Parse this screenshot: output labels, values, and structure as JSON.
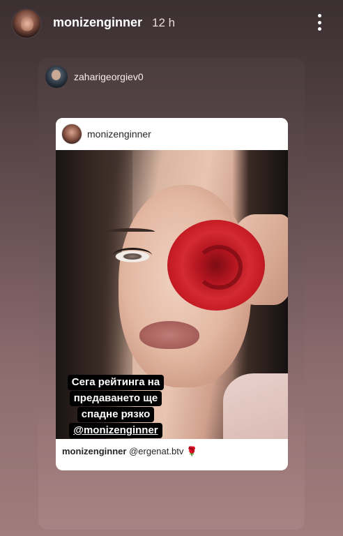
{
  "story": {
    "username": "monizenginner",
    "time": "12 h",
    "more_icon": "more-vertical-icon"
  },
  "shared_post": {
    "username": "zaharigeorgiev0"
  },
  "inner_post": {
    "username": "monizenginner",
    "caption_user": "monizenginner",
    "caption_mention": "@ergenat.btv",
    "caption_emoji": "🌹"
  },
  "sticker": {
    "line1": "Сега рейтинга на",
    "line2": "предаването ще",
    "line3": "спадне рязко",
    "mention": "@monizenginner"
  }
}
